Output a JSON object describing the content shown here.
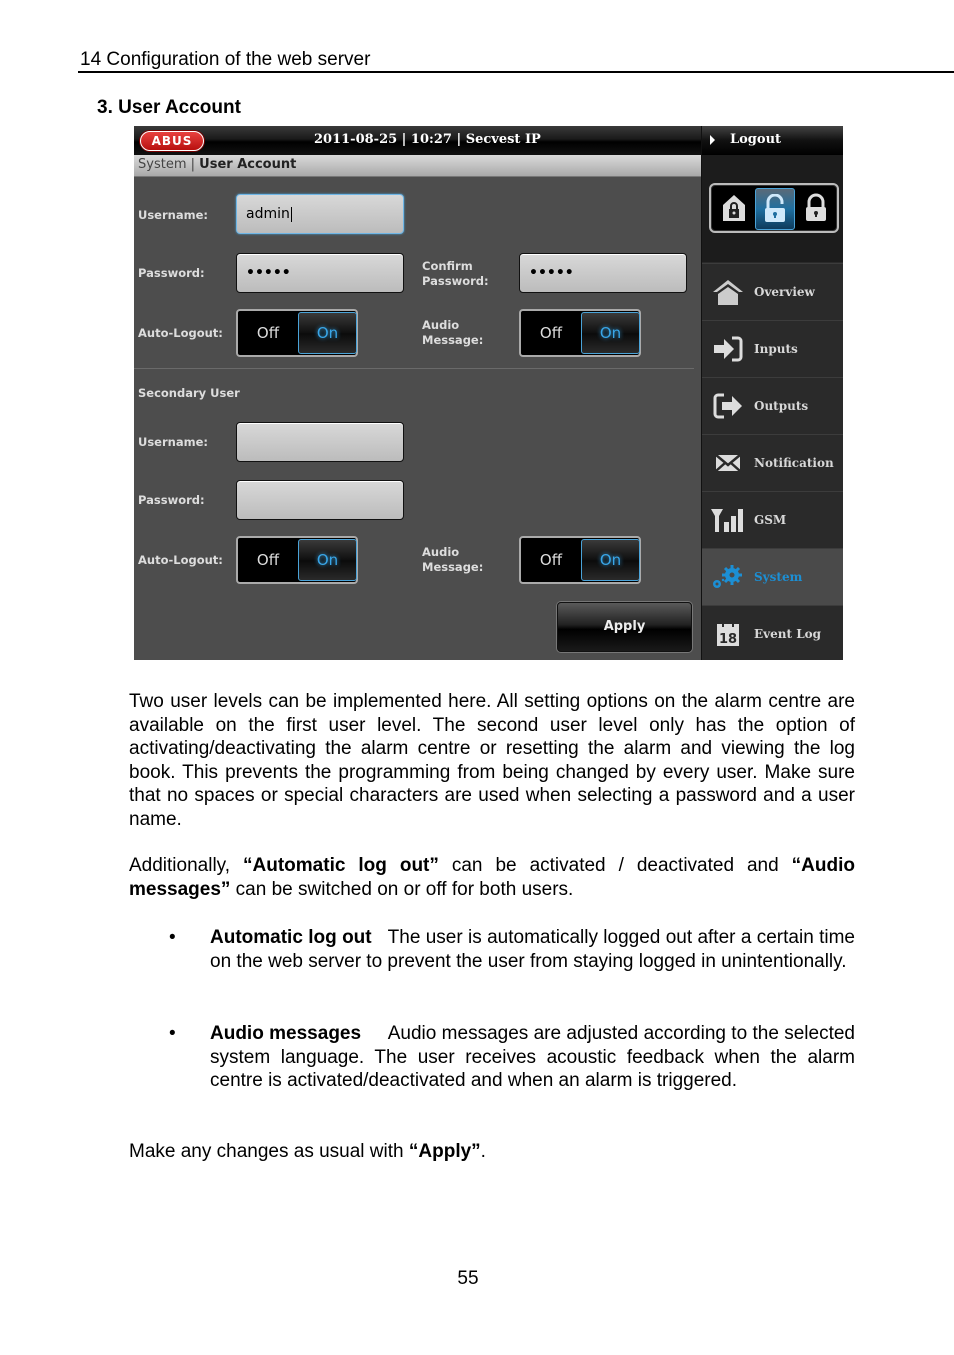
{
  "page": {
    "running_head": "14  Configuration of the web server",
    "section_title": "3.  User Account",
    "page_number": "55"
  },
  "ui": {
    "brand": "ABUS",
    "topbar_info": "2011-08-25  |  10:27  |  Secvest IP",
    "breadcrumb": {
      "parent": "System",
      "separator": "|",
      "current": "User Account"
    },
    "logout_label": "Logout",
    "arm_modes": [
      {
        "name": "home-armed",
        "active": false
      },
      {
        "name": "disarmed",
        "active": true
      },
      {
        "name": "armed",
        "active": false
      }
    ],
    "nav": [
      {
        "label": "Overview",
        "icon": "home-icon",
        "active": false
      },
      {
        "label": "Inputs",
        "icon": "input-arrow-icon",
        "active": false
      },
      {
        "label": "Outputs",
        "icon": "output-arrow-icon",
        "active": false
      },
      {
        "label": "Notification",
        "icon": "envelope-icon",
        "active": false
      },
      {
        "label": "GSM",
        "icon": "signal-bars-icon",
        "active": false
      },
      {
        "label": "System",
        "icon": "gears-icon",
        "active": true
      },
      {
        "label": "Event Log",
        "icon": "calendar-icon",
        "active": false
      }
    ],
    "primary": {
      "username_label": "Username:",
      "username_value": "admin",
      "password_label": "Password:",
      "password_value": "•••••",
      "confirm_label_1": "Confirm",
      "confirm_label_2": "Password:",
      "confirm_value": "•••••",
      "autologout_label": "Auto-Logout:",
      "audio_label_1": "Audio",
      "audio_label_2": "Message:",
      "autologout_state": "On",
      "audio_state": "On"
    },
    "secondary": {
      "heading": "Secondary User",
      "username_label": "Username:",
      "username_value": "",
      "password_label": "Password:",
      "password_value": "",
      "autologout_label": "Auto-Logout:",
      "audio_label_1": "Audio",
      "audio_label_2": "Message:",
      "autologout_state": "On",
      "audio_state": "On"
    },
    "toggle_off_label": "Off",
    "toggle_on_label": "On",
    "apply_label": "Apply"
  },
  "text": {
    "para1": "Two user levels can be implemented here. All setting options on the alarm centre are available on the first user level. The second user level only has the option of activating/deactivating the alarm centre or resetting the alarm and viewing the log book. This prevents the programming from being changed by every user. Make sure that no spaces or special characters are used when selecting a password and a user name.",
    "para2_a": "Additionally, ",
    "para2_b": "“Automatic log out”",
    "para2_c": " can be activated / deactivated  and ",
    "para2_d": "“Audio messages”",
    "para2_e": " can be switched on or off for both users.",
    "bullets": [
      {
        "term": "Automatic log out",
        "desc": "The user is automatically logged out after a certain time on the web server to prevent the user from staying logged in unintentionally."
      },
      {
        "term": "Audio messages",
        "desc": "Audio messages are adjusted according to the selected system language. The user receives acoustic feedback when the alarm centre is activated/deactivated and when an alarm is triggered."
      }
    ],
    "bullet_char": "•",
    "para3_a": "Make any changes as usual with ",
    "para3_b": "“Apply”",
    "para3_c": "."
  }
}
